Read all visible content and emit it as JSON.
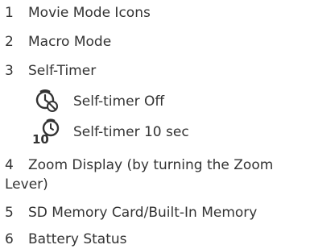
{
  "list": [
    {
      "num": "1",
      "text": "Movie Mode Icons"
    },
    {
      "num": "2",
      "text": "Macro Mode"
    },
    {
      "num": "3",
      "text": "Self-Timer"
    },
    {
      "num": "4",
      "text": "Zoom Display (by turning the Zoom",
      "text_cont": "Lever)"
    },
    {
      "num": "5",
      "text": "SD Memory Card/Built-In Memory"
    },
    {
      "num": "6",
      "text": "Battery Status"
    }
  ],
  "self_timer_options": [
    {
      "icon": "self-timer-off-icon",
      "label": "Self-timer Off"
    },
    {
      "icon": "self-timer-10-sec-icon",
      "label": "Self-timer 10 sec",
      "icon_text": "10"
    }
  ]
}
